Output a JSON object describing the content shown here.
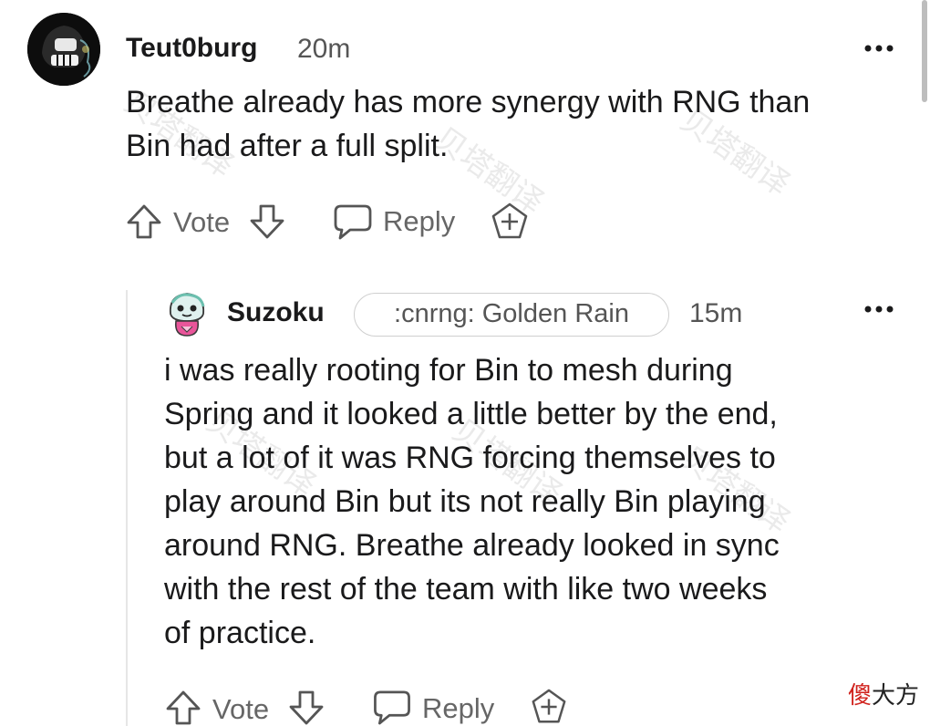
{
  "colors": {
    "text": "#1a1a1b",
    "muted": "#666666",
    "flair_border": "#cfcfcf",
    "thread_line": "#e6e6e6",
    "corner_accent": "#d0211c"
  },
  "comments": [
    {
      "username": "Teut0burg",
      "time": "20m",
      "avatar_icon": "dark-character-avatar-icon",
      "body": [
        "Breathe already has more synergy with RNG than",
        "Bin had after a full split."
      ],
      "actions": {
        "vote": "Vote",
        "reply": "Reply"
      }
    },
    {
      "username": "Suzoku",
      "flair": ":cnrng: Golden Rain",
      "time": "15m",
      "avatar_icon": "cartoon-character-avatar-icon",
      "body": [
        "i was really rooting for Bin to mesh during",
        "Spring and it looked a little better by the end,",
        "but a lot of it was RNG forcing themselves to",
        "play around Bin but its not really Bin playing",
        "around RNG. Breathe already looked in sync",
        "with the rest of the team with like two weeks",
        "of practice."
      ],
      "actions": {
        "vote": "Vote",
        "reply": "Reply"
      }
    }
  ],
  "watermark": "贝塔翻译",
  "corner_mark": {
    "accent": "傻",
    "rest": "大方"
  }
}
